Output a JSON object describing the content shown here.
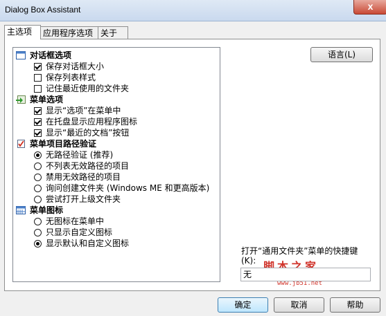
{
  "window": {
    "title": "Dialog Box Assistant",
    "close_glyph": "x"
  },
  "tabs": [
    {
      "label": "主选项",
      "active": true
    },
    {
      "label": "应用程序选项",
      "active": false
    },
    {
      "label": "关于",
      "active": false
    }
  ],
  "groups": [
    {
      "label": "对话框选项",
      "icon": "window-icon",
      "items": [
        {
          "type": "checkbox",
          "label": "保存对话框大小",
          "checked": true
        },
        {
          "type": "checkbox",
          "label": "保存列表样式",
          "checked": false
        },
        {
          "type": "checkbox",
          "label": "记住最近使用的文件夹",
          "checked": false
        }
      ]
    },
    {
      "label": "菜单选项",
      "icon": "menu-arrow-icon",
      "items": [
        {
          "type": "checkbox",
          "label": "显示“选项”在菜单中",
          "checked": true
        },
        {
          "type": "checkbox",
          "label": "在托盘显示应用程序图标",
          "checked": true
        },
        {
          "type": "checkbox",
          "label": "显示“最近的文档”按钮",
          "checked": true
        }
      ]
    },
    {
      "label": "菜单项目路径验证",
      "icon": "document-check-icon",
      "items": [
        {
          "type": "radio",
          "label": "无路径验证 (推荐)",
          "checked": true
        },
        {
          "type": "radio",
          "label": "不列表无效路径的项目",
          "checked": false
        },
        {
          "type": "radio",
          "label": "禁用无效路径的项目",
          "checked": false
        },
        {
          "type": "radio",
          "label": "询问创建文件夹 (Windows ME 和更高版本)",
          "checked": false
        },
        {
          "type": "radio",
          "label": "尝试打开上级文件夹",
          "checked": false
        }
      ]
    },
    {
      "label": "菜单图标",
      "icon": "grid-icon",
      "items": [
        {
          "type": "radio",
          "label": "无图标在菜单中",
          "checked": false
        },
        {
          "type": "radio",
          "label": "只显示自定义图标",
          "checked": false
        },
        {
          "type": "radio",
          "label": "显示默认和自定义图标",
          "checked": true
        }
      ]
    }
  ],
  "language_button": "语言(L)",
  "shortcut": {
    "label": "打开“通用文件夹”菜单的快捷键(K):",
    "value": "无"
  },
  "watermark": {
    "text": "脚本之家",
    "url": "www.jb51.net"
  },
  "buttons": {
    "ok": "确定",
    "cancel": "取消",
    "help": "帮助"
  },
  "colors": {
    "default_button": "#bee6fd",
    "title_bar": "#c9d9ee",
    "close_button": "#c94a36",
    "watermark": "#d0332a"
  }
}
